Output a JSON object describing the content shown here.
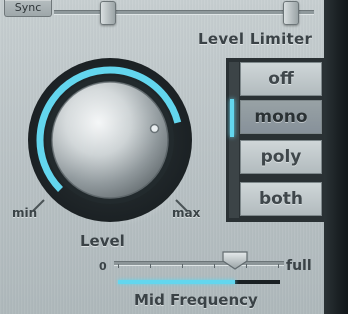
{
  "sync_button": {
    "label": "Sync"
  },
  "level_limiter": {
    "title": "Level Limiter",
    "options": [
      "off",
      "mono",
      "poly",
      "both"
    ],
    "selected": "mono"
  },
  "level_knob": {
    "title": "Level",
    "min_label": "min",
    "max_label": "max",
    "value_fraction": 0.78
  },
  "mid_frequency": {
    "title": "Mid Frequency",
    "min_label": "0",
    "max_label": "full",
    "value_fraction": 0.72
  },
  "colors": {
    "accent": "#63d6ee",
    "panel": "#b8c1c4",
    "text": "#3a4246",
    "dark_edge": "#1a2023"
  }
}
